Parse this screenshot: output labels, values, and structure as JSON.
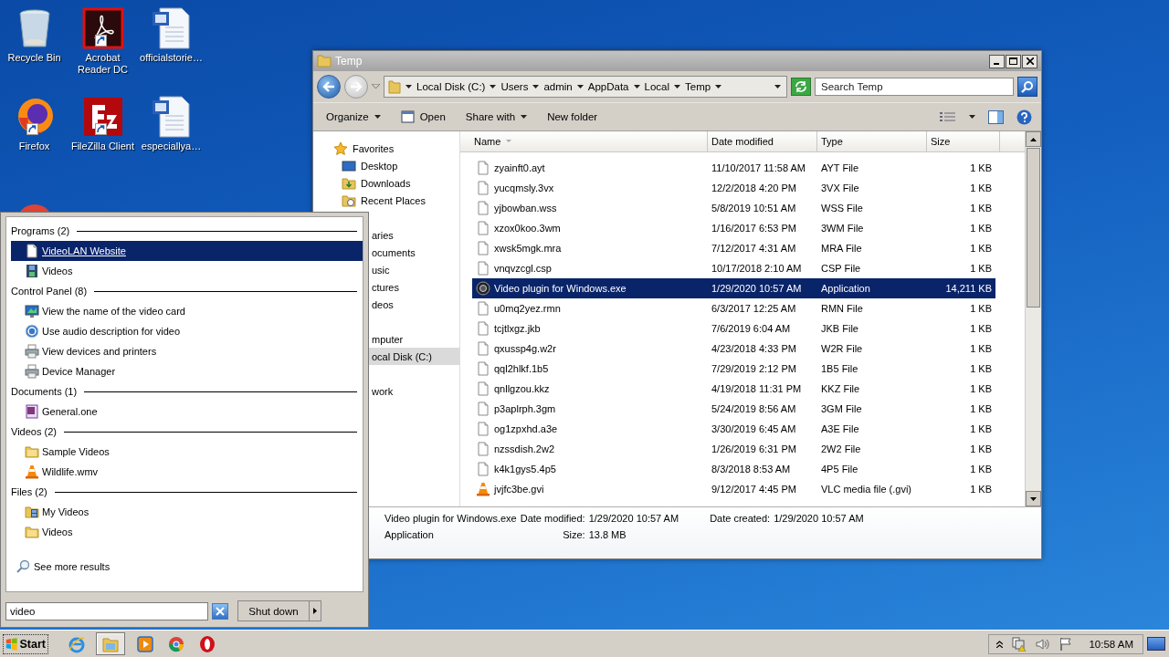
{
  "desktop": {
    "icons": [
      {
        "label": "Recycle Bin",
        "kind": "bin",
        "shortcut": false
      },
      {
        "label": "Acrobat Reader DC",
        "kind": "acrobat",
        "shortcut": true
      },
      {
        "label": "officialstorie…",
        "kind": "word",
        "shortcut": false
      },
      {
        "label": "Firefox",
        "kind": "firefox",
        "shortcut": true
      },
      {
        "label": "FileZilla Client",
        "kind": "filezilla",
        "shortcut": true
      },
      {
        "label": "especiallya…",
        "kind": "word",
        "shortcut": false
      },
      {
        "kind": "chrome"
      }
    ]
  },
  "explorer": {
    "title": "Temp",
    "address": [
      "Local Disk (C:)",
      "Users",
      "admin",
      "AppData",
      "Local",
      "Temp"
    ],
    "search": {
      "placeholder": "Search Temp"
    },
    "toolbar": [
      {
        "label": "Organize",
        "kind": "menu"
      },
      {
        "label": "Open",
        "kind": "open"
      },
      {
        "label": "Share with",
        "kind": "menu"
      },
      {
        "label": "New folder",
        "kind": "plain"
      }
    ],
    "nav": {
      "favorites": {
        "label": "Favorites",
        "children": [
          {
            "label": "Desktop",
            "kind": "desktop"
          },
          {
            "label": "Downloads",
            "kind": "downloads"
          },
          {
            "label": "Recent Places",
            "kind": "recent"
          }
        ]
      },
      "covered_groups": [
        {
          "items": [
            {
              "label": "aries",
              "selected": false
            },
            {
              "label": "ocuments",
              "selected": false
            },
            {
              "label": "usic",
              "selected": false
            },
            {
              "label": "ctures",
              "selected": false
            },
            {
              "label": "deos",
              "selected": false
            }
          ]
        },
        {
          "items": [
            {
              "label": "mputer",
              "selected": false
            },
            {
              "label": "ocal Disk (C:)",
              "selected": true
            }
          ]
        },
        {
          "items": [
            {
              "label": "work",
              "selected": false
            }
          ]
        }
      ]
    },
    "columns": [
      "Name",
      "Date modified",
      "Type",
      "Size"
    ],
    "rows": [
      {
        "name": "zyainft0.ayt",
        "date": "11/10/2017 11:58 AM",
        "type": "AYT File",
        "size": "1 KB",
        "kind": "page",
        "selected": false
      },
      {
        "name": "yucqmsly.3vx",
        "date": "12/2/2018 4:20 PM",
        "type": "3VX File",
        "size": "1 KB",
        "kind": "page",
        "selected": false
      },
      {
        "name": "yjbowban.wss",
        "date": "5/8/2019 10:51 AM",
        "type": "WSS File",
        "size": "1 KB",
        "kind": "page",
        "selected": false
      },
      {
        "name": "xzox0koo.3wm",
        "date": "1/16/2017 6:53 PM",
        "type": "3WM File",
        "size": "1 KB",
        "kind": "page",
        "selected": false
      },
      {
        "name": "xwsk5mgk.mra",
        "date": "7/12/2017 4:31 AM",
        "type": "MRA File",
        "size": "1 KB",
        "kind": "page",
        "selected": false
      },
      {
        "name": "vnqvzcgl.csp",
        "date": "10/17/2018 2:10 AM",
        "type": "CSP File",
        "size": "1 KB",
        "kind": "page",
        "selected": false
      },
      {
        "name": "Video plugin for Windows.exe",
        "date": "1/29/2020 10:57 AM",
        "type": "Application",
        "size": "14,211 KB",
        "kind": "app",
        "selected": true
      },
      {
        "name": "u0mq2yez.rmn",
        "date": "6/3/2017 12:25 AM",
        "type": "RMN File",
        "size": "1 KB",
        "kind": "page",
        "selected": false
      },
      {
        "name": "tcjtlxgz.jkb",
        "date": "7/6/2019 6:04 AM",
        "type": "JKB File",
        "size": "1 KB",
        "kind": "page",
        "selected": false
      },
      {
        "name": "qxussp4g.w2r",
        "date": "4/23/2018 4:33 PM",
        "type": "W2R File",
        "size": "1 KB",
        "kind": "page",
        "selected": false
      },
      {
        "name": "qql2hlkf.1b5",
        "date": "7/29/2019 2:12 PM",
        "type": "1B5 File",
        "size": "1 KB",
        "kind": "page",
        "selected": false
      },
      {
        "name": "qnllgzou.kkz",
        "date": "4/19/2018 11:31 PM",
        "type": "KKZ File",
        "size": "1 KB",
        "kind": "page",
        "selected": false
      },
      {
        "name": "p3aplrph.3gm",
        "date": "5/24/2019 8:56 AM",
        "type": "3GM File",
        "size": "1 KB",
        "kind": "page",
        "selected": false
      },
      {
        "name": "og1zpxhd.a3e",
        "date": "3/30/2019 6:45 AM",
        "type": "A3E File",
        "size": "1 KB",
        "kind": "page",
        "selected": false
      },
      {
        "name": "nzssdish.2w2",
        "date": "1/26/2019 6:31 PM",
        "type": "2W2 File",
        "size": "1 KB",
        "kind": "page",
        "selected": false
      },
      {
        "name": "k4k1gys5.4p5",
        "date": "8/3/2018 8:53 AM",
        "type": "4P5 File",
        "size": "1 KB",
        "kind": "page",
        "selected": false
      },
      {
        "name": "jvjfc3be.gvi",
        "date": "9/12/2017 4:45 PM",
        "type": "VLC media file (.gvi)",
        "size": "1 KB",
        "kind": "cone",
        "selected": false
      }
    ],
    "details": {
      "name": "Video plugin for Windows.exe",
      "type": "Application",
      "modified_label": "Date modified:",
      "modified": "1/29/2020 10:57 AM",
      "size_label": "Size:",
      "size": "13.8 MB",
      "created_label": "Date created:",
      "created": "1/29/2020 10:57 AM"
    }
  },
  "start_menu": {
    "sections": [
      {
        "title": "Programs (2)",
        "items": [
          {
            "label": "VideoLAN Website",
            "kind": "page",
            "selected": true
          },
          {
            "label": "Videos",
            "kind": "film",
            "selected": false
          }
        ]
      },
      {
        "title": "Control Panel (8)",
        "items": [
          {
            "label": "View the name of the video card",
            "kind": "monitor",
            "selected": false
          },
          {
            "label": "Use audio description for video",
            "kind": "audio",
            "selected": false
          },
          {
            "label": "View devices and printers",
            "kind": "printer",
            "selected": false
          },
          {
            "label": "Device Manager",
            "kind": "printer",
            "selected": false
          }
        ]
      },
      {
        "title": "Documents (1)",
        "items": [
          {
            "label": "General.one",
            "kind": "notebook",
            "selected": false
          }
        ]
      },
      {
        "title": "Videos (2)",
        "items": [
          {
            "label": "Sample Videos",
            "kind": "folder",
            "selected": false
          },
          {
            "label": "Wildlife.wmv",
            "kind": "cone",
            "selected": false
          }
        ]
      },
      {
        "title": "Files (2)",
        "items": [
          {
            "label": "My Videos",
            "kind": "folder-film",
            "selected": false
          },
          {
            "label": "Videos",
            "kind": "folder",
            "selected": false
          }
        ]
      }
    ],
    "see_more": "See more results",
    "search": {
      "value": "video"
    },
    "shutdown": "Shut down"
  },
  "taskbar": {
    "start": "Start",
    "apps": [
      {
        "kind": "ie",
        "active": false
      },
      {
        "kind": "explorer",
        "active": true
      },
      {
        "kind": "media",
        "active": false
      },
      {
        "kind": "chrome",
        "active": false
      },
      {
        "kind": "opera",
        "active": false
      }
    ],
    "clock": "10:58 AM"
  }
}
